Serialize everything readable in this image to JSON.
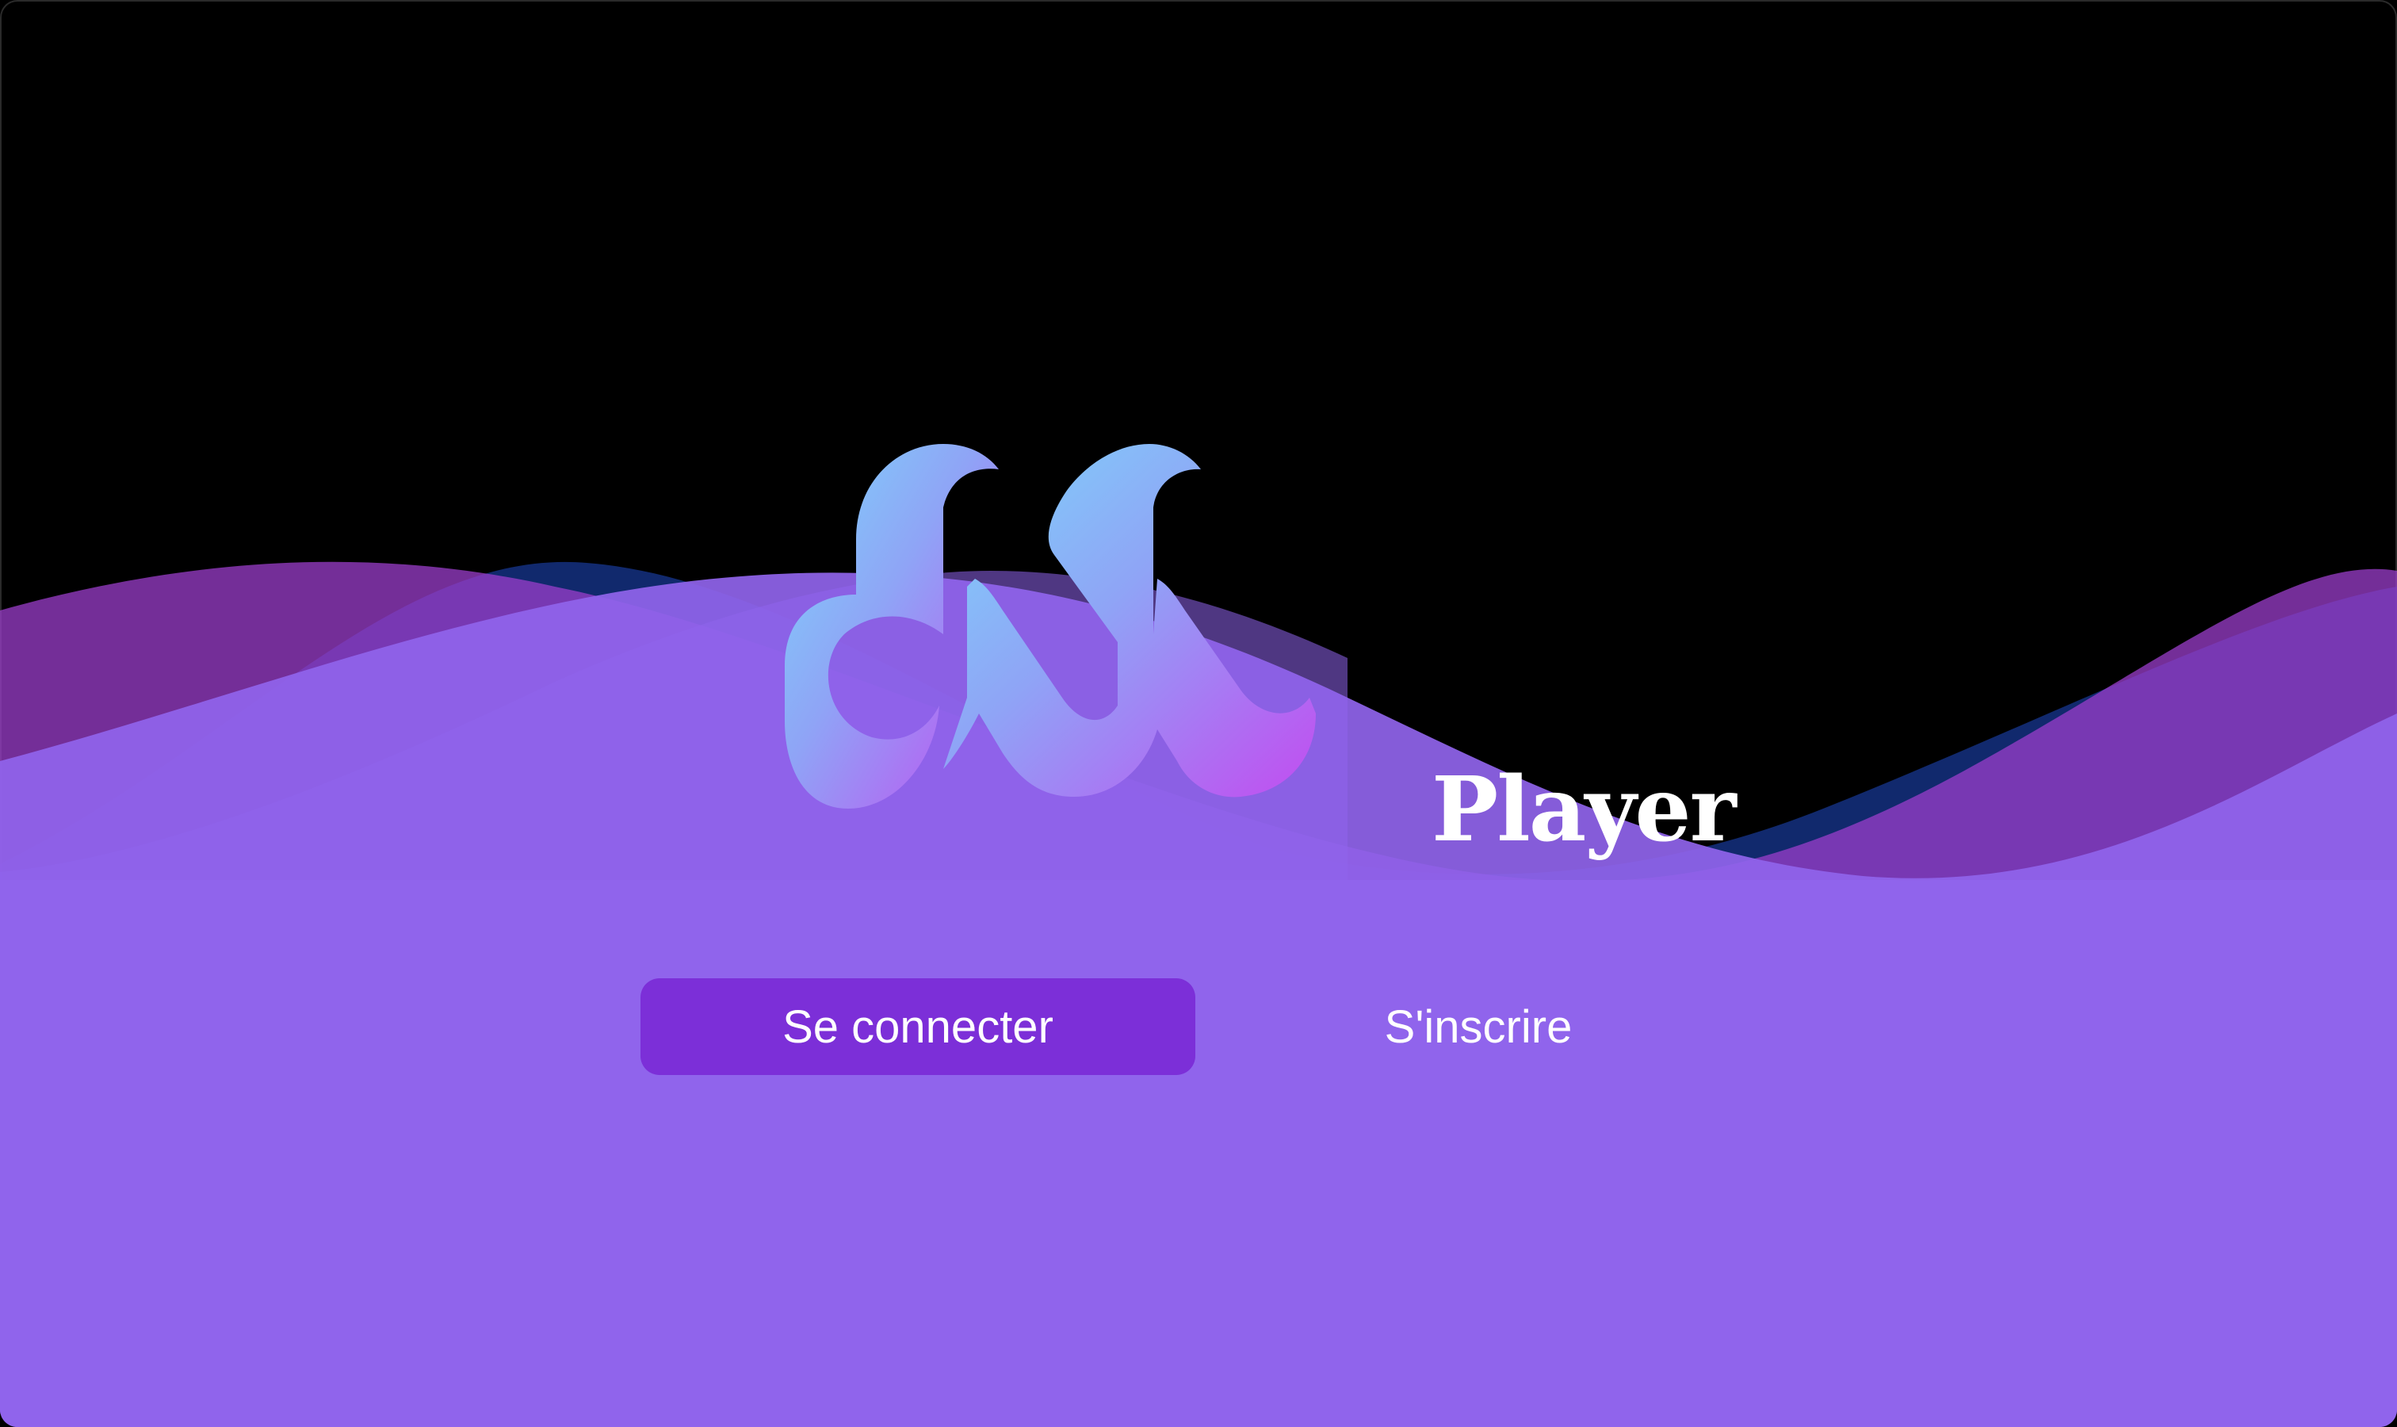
{
  "app": {
    "brand_name": "Player",
    "logo_icon": "dm-wave-logo-icon"
  },
  "actions": {
    "login_label": "Se connecter",
    "signup_label": "S'inscrire"
  },
  "colors": {
    "background": "#000000",
    "wave_purple": "#9064EC",
    "wave_magenta": "#9B3DCB",
    "wave_blue": "#3D7DD8",
    "primary_button": "#7C2FD8",
    "logo_gradient_start": "#7DD8FA",
    "logo_gradient_end": "#C24CF0",
    "text": "#FFFFFF"
  }
}
